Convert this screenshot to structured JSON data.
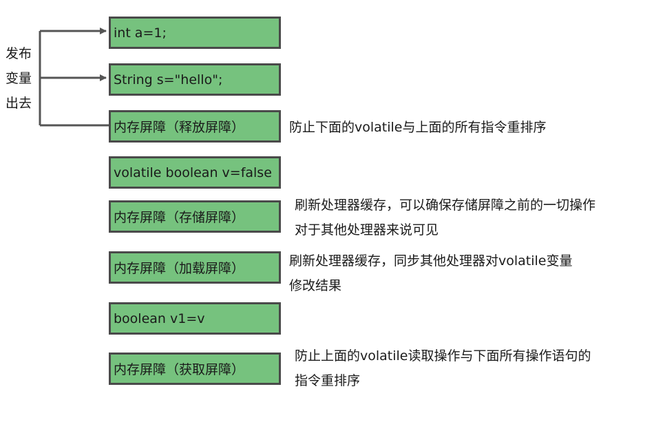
{
  "side_label": [
    "发布",
    "变量",
    "出去"
  ],
  "boxes": [
    "int a=1;",
    "String s=\"hello\";",
    "内存屏障（释放屏障）",
    "volatile boolean v=false",
    "内存屏障（存储屏障）",
    "内存屏障（加载屏障）",
    "boolean v1=v",
    "内存屏障（获取屏障）"
  ],
  "notes": {
    "release": [
      "防止下面的volatile与上面的所有指令重排序"
    ],
    "store": [
      "刷新处理器缓存，可以确保存储屏障之前的一切操作",
      "对于其他处理器来说可见"
    ],
    "load": [
      "刷新处理器缓存，同步其他处理器对volatile变量",
      "修改结果"
    ],
    "acquire": [
      "防止上面的volatile读取操作与下面所有操作语句的",
      "指令重排序"
    ]
  },
  "colors": {
    "box_fill": "#76c27e",
    "box_border": "#4a4a4a",
    "arrow": "#555555"
  }
}
